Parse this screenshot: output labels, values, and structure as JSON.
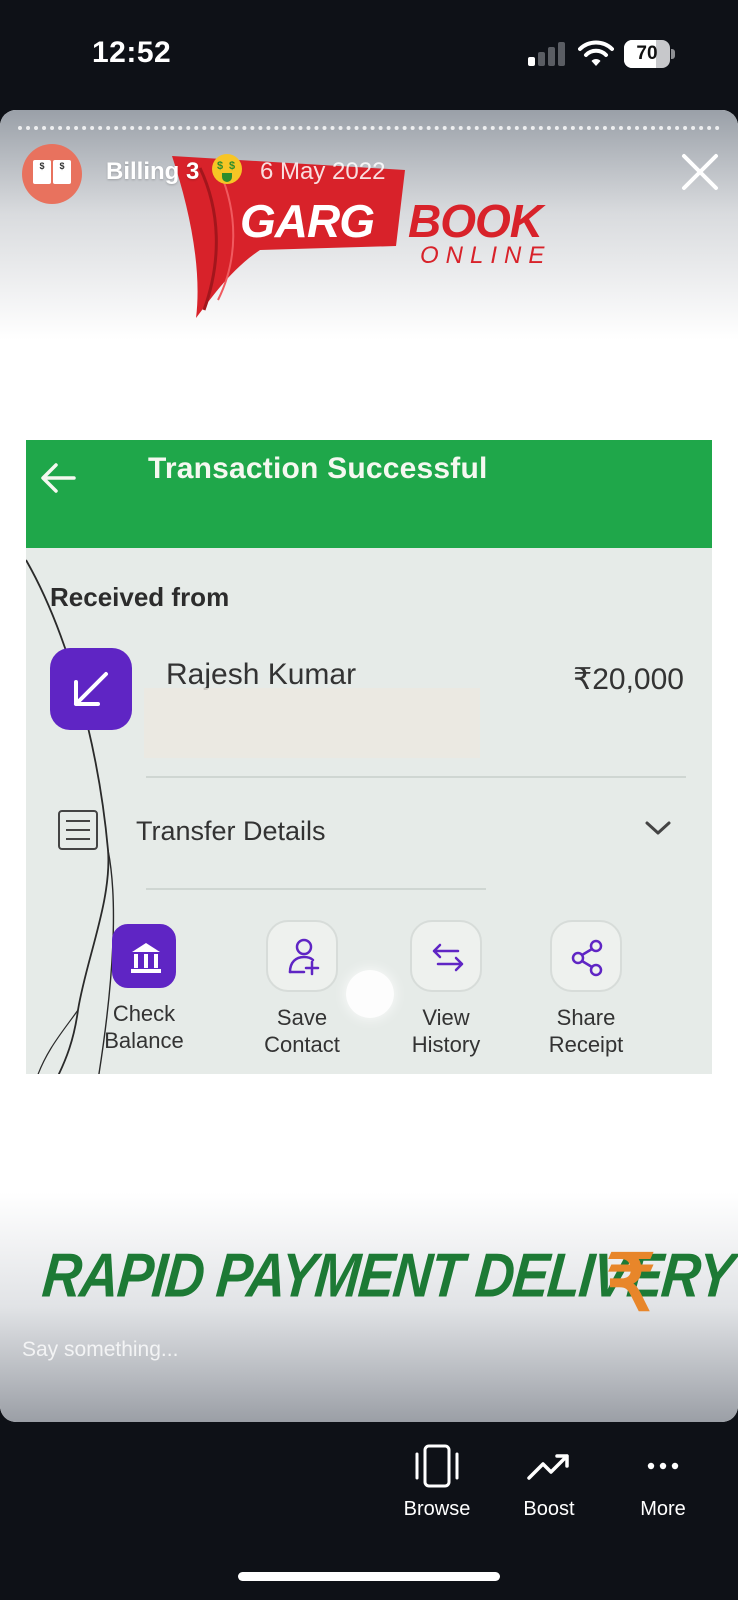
{
  "status_bar": {
    "time": "12:52",
    "battery": "70",
    "battery_level": 0.7,
    "signal_bars_active": 1
  },
  "story": {
    "username": "Billing 3",
    "emoji": "money-mouth-face",
    "date": "6 May 2022",
    "logo": {
      "word1": "GARG",
      "word2": "BOOK",
      "word3": "ONLINE"
    },
    "screenshot": {
      "header_title": "Transaction Successful",
      "received_label": "Received from",
      "payer_name": "Rajesh Kumar",
      "amount": "₹20,000",
      "transfer_details": "Transfer Details",
      "actions": [
        {
          "label_1": "Check",
          "label_2": "Balance",
          "icon": "bank-icon"
        },
        {
          "label_1": "Save",
          "label_2": "Contact",
          "icon": "add-contact-icon"
        },
        {
          "label_1": "View",
          "label_2": "History",
          "icon": "swap-arrows-icon"
        },
        {
          "label_1": "Share",
          "label_2": "Receipt",
          "icon": "share-icon"
        }
      ]
    },
    "banner": "RAPID PAYMENT DELIVERY",
    "banner_symbol": "₹",
    "reply_placeholder": "Say something..."
  },
  "bottom_bar": {
    "browse": "Browse",
    "boost": "Boost",
    "more": "More"
  },
  "colors": {
    "green": "#1fa74a",
    "purple": "#5f25c4",
    "logo_red": "#d8222a",
    "banner_green": "#1d7a35",
    "rupee_orange": "#e8862a",
    "background": "#0e1117"
  }
}
